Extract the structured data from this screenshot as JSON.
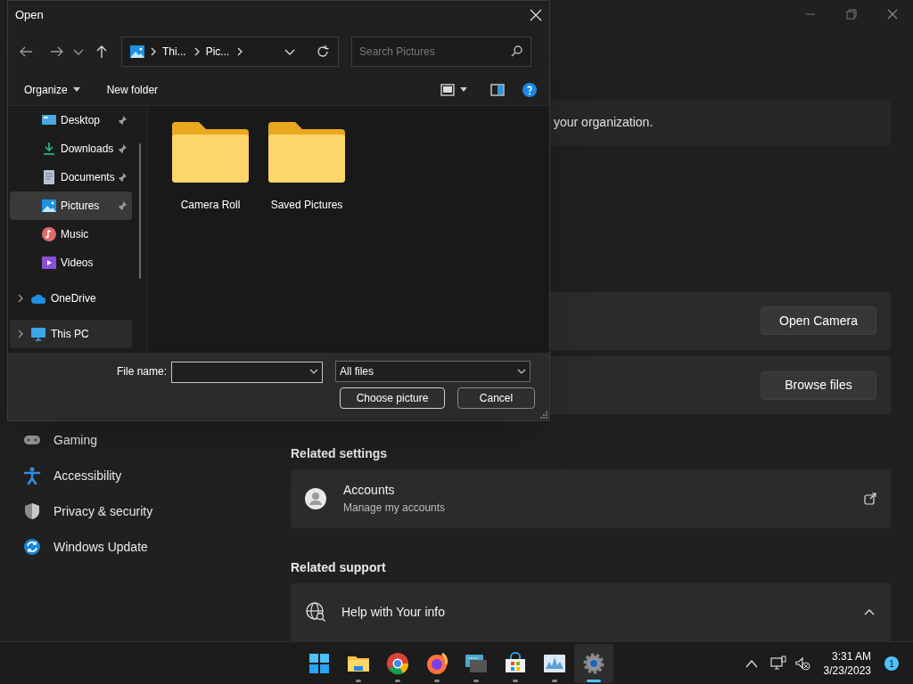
{
  "settings_window": {
    "nav_items": [
      {
        "label": "Gaming"
      },
      {
        "label": "Accessibility"
      },
      {
        "label": "Privacy & security"
      },
      {
        "label": "Windows Update"
      }
    ],
    "notice": "your organization.",
    "action_rows": [
      {
        "button": "Open Camera"
      },
      {
        "button": "Browse files"
      }
    ],
    "related_settings": {
      "heading": "Related settings",
      "items": [
        {
          "title": "Accounts",
          "subtitle": "Manage my accounts"
        }
      ]
    },
    "related_support": {
      "heading": "Related support",
      "items": [
        {
          "title": "Help with Your info",
          "expanded": true
        }
      ]
    }
  },
  "dialog": {
    "title": "Open",
    "breadcrumb": [
      "Thi...",
      "Pic..."
    ],
    "search": {
      "placeholder": "Search Pictures"
    },
    "toolbar": {
      "organize": "Organize",
      "new_folder": "New folder"
    },
    "quick_access": [
      {
        "label": "Desktop",
        "pinned": true,
        "selected": false
      },
      {
        "label": "Downloads",
        "pinned": true,
        "selected": false
      },
      {
        "label": "Documents",
        "pinned": true,
        "selected": false
      },
      {
        "label": "Pictures",
        "pinned": true,
        "selected": true
      },
      {
        "label": "Music",
        "pinned": false,
        "selected": false
      },
      {
        "label": "Videos",
        "pinned": false,
        "selected": false
      }
    ],
    "locations": [
      {
        "label": "OneDrive",
        "expanded": false,
        "highlighted": false
      },
      {
        "label": "This PC",
        "expanded": false,
        "highlighted": true
      }
    ],
    "folders": [
      {
        "label": "Camera Roll"
      },
      {
        "label": "Saved Pictures"
      }
    ],
    "file_name": {
      "label": "File name:"
    },
    "file_type": {
      "value": "All files"
    },
    "buttons": {
      "primary": "Choose picture",
      "cancel": "Cancel"
    }
  },
  "taskbar": {
    "apps": [
      {
        "running": false,
        "active": false
      },
      {
        "running": true,
        "active": false
      },
      {
        "running": true,
        "active": false
      },
      {
        "running": true,
        "active": false
      },
      {
        "running": true,
        "active": false
      },
      {
        "running": true,
        "active": false
      },
      {
        "running": true,
        "active": false
      },
      {
        "running": true,
        "active": true
      }
    ],
    "time": "3:31 AM",
    "date": "3/23/2023",
    "notifications": "1"
  }
}
